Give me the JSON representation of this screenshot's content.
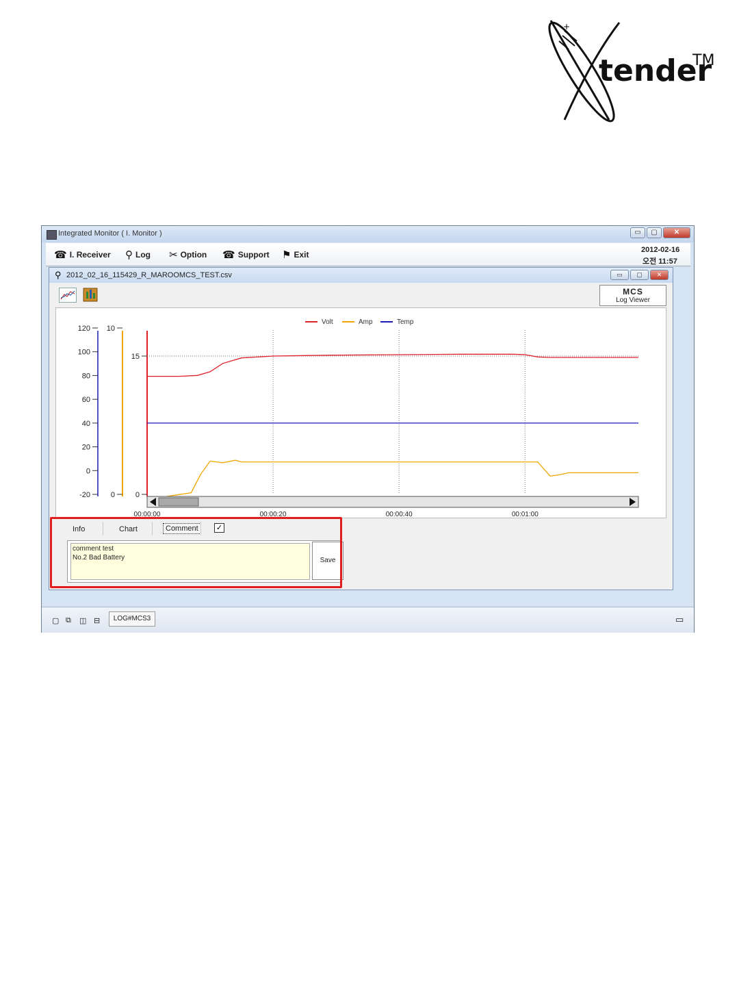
{
  "logo": {
    "text": "tender",
    "tm": "TM"
  },
  "window": {
    "title": "Integrated Monitor ( I. Monitor )",
    "controls": {
      "minimize": "▭",
      "maximize": "▢",
      "close": "✕"
    }
  },
  "toolbar": {
    "items": [
      {
        "label": "I. Receiver",
        "icon": "receiver-icon"
      },
      {
        "label": "Log",
        "icon": "magnifier-icon"
      },
      {
        "label": "Option",
        "icon": "tools-icon"
      },
      {
        "label": "Support",
        "icon": "telephone-icon"
      },
      {
        "label": "Exit",
        "icon": "running-man-icon"
      }
    ],
    "date": "2012-02-16",
    "time": "오전 11:57"
  },
  "inner_window": {
    "title": "2012_02_16_115429_R_MAROOMCS_TEST.csv",
    "mcs_title": "MCS",
    "mcs_subtitle": "Log Viewer"
  },
  "chart_data": {
    "type": "line",
    "legend": [
      "Volt",
      "Amp",
      "Temp"
    ],
    "colors": {
      "Volt": "#e0202a",
      "Amp": "#f0a500",
      "Temp": "#1a1ab4"
    },
    "y_axes": [
      {
        "ticks": [
          "120",
          "100",
          "80",
          "60",
          "40",
          "20",
          "0",
          "-20"
        ],
        "range": [
          -20,
          120
        ],
        "color": "#1a1ab4"
      },
      {
        "ticks": [
          "10",
          "0"
        ],
        "range": [
          0,
          10
        ],
        "color": "#f0a500"
      },
      {
        "ticks": [
          "15",
          "0"
        ],
        "color": "#e0202a"
      }
    ],
    "x_ticks": [
      "00:00:00",
      "00:00:20",
      "00:00:40",
      "00:01:00"
    ],
    "series": [
      {
        "name": "Volt",
        "t": [
          0,
          5,
          8,
          10,
          12,
          15,
          20,
          25,
          30,
          40,
          50,
          58,
          60,
          62,
          64,
          78
        ],
        "v": [
          12.8,
          12.8,
          12.9,
          13.3,
          14.2,
          14.8,
          15.0,
          15.05,
          15.1,
          15.15,
          15.2,
          15.2,
          15.15,
          14.9,
          14.85,
          14.85
        ]
      },
      {
        "name": "Amp",
        "t": [
          0,
          7,
          8.5,
          10,
          12,
          14,
          15,
          20,
          40,
          62,
          64,
          65,
          67,
          78
        ],
        "v": [
          -0.3,
          0.1,
          1.2,
          2.0,
          1.9,
          2.05,
          1.95,
          1.95,
          1.95,
          1.95,
          1.1,
          1.15,
          1.3,
          1.3
        ]
      },
      {
        "name": "Temp",
        "t": [
          0,
          78
        ],
        "v": [
          40,
          40
        ]
      }
    ]
  },
  "tabs": {
    "info": "Info",
    "chart": "Chart",
    "comment": "Comment",
    "check": "✓"
  },
  "comment": {
    "line1": "comment test",
    "line2": "No.2 Bad Battery",
    "save_label": "Save"
  },
  "statusbar": {
    "tab_label": "LOG#MCS3"
  }
}
